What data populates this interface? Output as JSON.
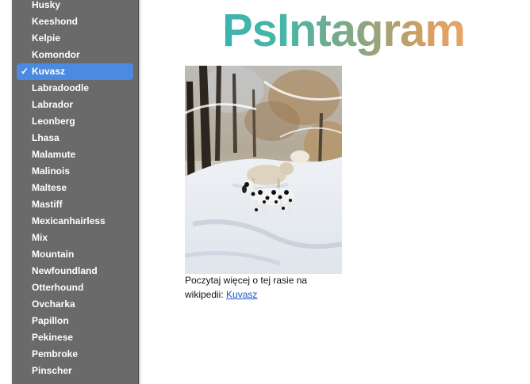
{
  "header": {
    "logo_text": "PsIntagram"
  },
  "breed_dropdown": {
    "options": [
      "Husky",
      "Keeshond",
      "Kelpie",
      "Komondor",
      "Kuvasz",
      "Labradoodle",
      "Labrador",
      "Leonberg",
      "Lhasa",
      "Malamute",
      "Malinois",
      "Maltese",
      "Mastiff",
      "Mexicanhairless",
      "Mix",
      "Mountain",
      "Newfoundland",
      "Otterhound",
      "Ovcharka",
      "Papillon",
      "Pekinese",
      "Pembroke",
      "Pinscher"
    ],
    "selected": "Kuvasz",
    "check_mark": "✓"
  },
  "main": {
    "caption_text": "Poczytaj więcej o tej rasie na wikipedii: ",
    "link_text": "Kuvasz"
  },
  "colors": {
    "menu_background": "#6a6a6a",
    "selected_background": "#4a8ae0",
    "link": "#1a55c4"
  }
}
